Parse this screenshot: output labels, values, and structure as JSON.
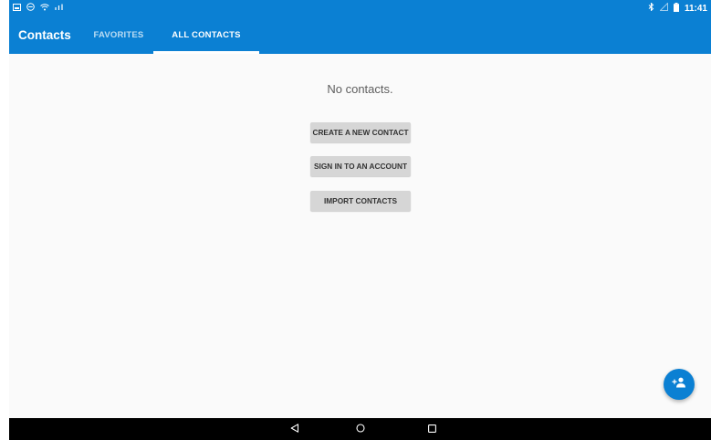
{
  "status_bar": {
    "time": "11:41",
    "left_icons": [
      "gallery-icon",
      "minus-circle-icon",
      "wifi-icon",
      "signal-icon"
    ],
    "right_icons": [
      "bluetooth-icon",
      "no-signal-icon",
      "battery-icon"
    ]
  },
  "app_bar": {
    "title": "Contacts",
    "tabs": [
      {
        "label": "FAVORITES",
        "selected": false
      },
      {
        "label": "ALL CONTACTS",
        "selected": true
      }
    ]
  },
  "content": {
    "empty_message": "No contacts.",
    "buttons": {
      "create": "CREATE A NEW CONTACT",
      "signin": "SIGN IN TO AN ACCOUNT",
      "import": "IMPORT CONTACTS"
    }
  },
  "fab": {
    "icon": "add-person-icon"
  },
  "nav_bar": {
    "icons": [
      "back-icon",
      "home-icon",
      "recents-icon"
    ]
  },
  "colors": {
    "primary": "#0b80d3",
    "background": "#fafafa",
    "button": "#d6d6d6"
  }
}
